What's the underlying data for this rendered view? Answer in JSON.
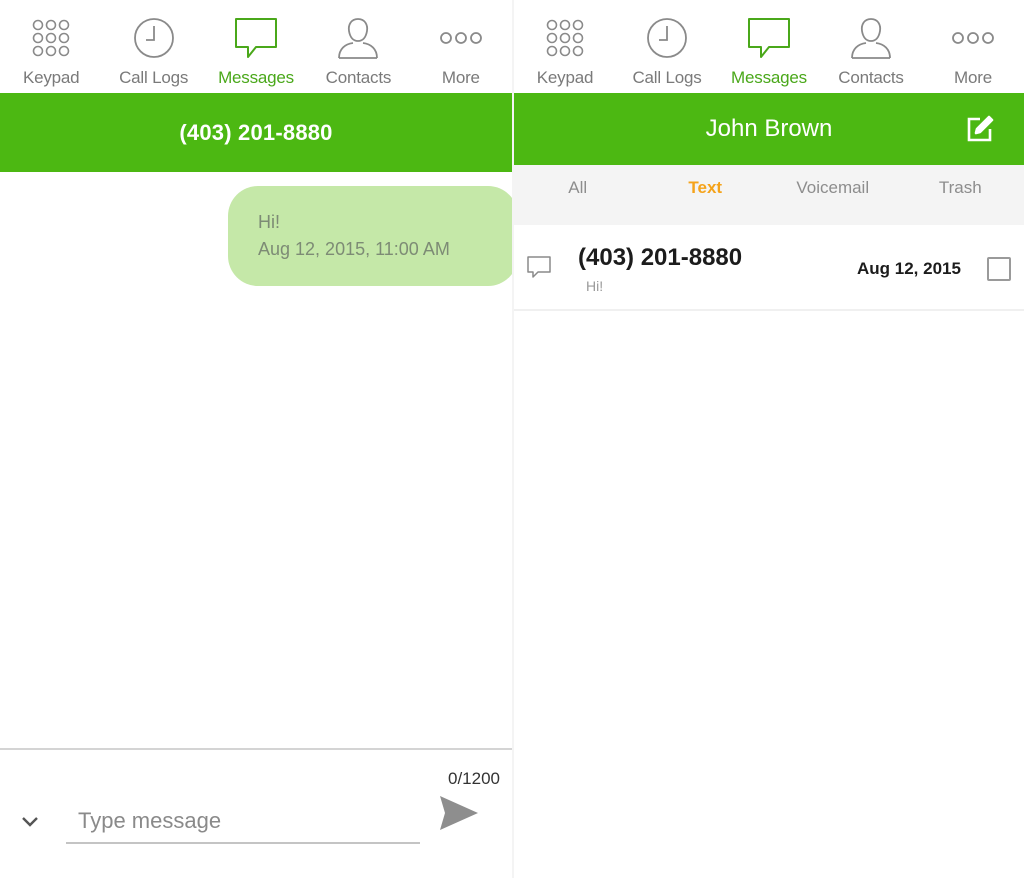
{
  "tabs": [
    {
      "label": "Keypad",
      "icon": "keypad-icon"
    },
    {
      "label": "Call Logs",
      "icon": "clock-icon"
    },
    {
      "label": "Messages",
      "icon": "chat-bubble-icon",
      "active": true
    },
    {
      "label": "Contacts",
      "icon": "person-icon"
    },
    {
      "label": "More",
      "icon": "more-dots-icon"
    }
  ],
  "colors": {
    "brand_green": "#4cb812",
    "active_tab_green": "#4aa81a",
    "bubble_green": "#c5e8a8",
    "filter_active_orange": "#f5a31a"
  },
  "conversation": {
    "title": "(403) 201-8880",
    "messages": [
      {
        "text": "Hi!",
        "time": "Aug 12, 2015, 11:00 AM",
        "direction": "outgoing"
      }
    ],
    "composer": {
      "placeholder": "Type message",
      "value": "",
      "counter": "0/1200"
    }
  },
  "inbox": {
    "title": "John Brown",
    "filters": [
      {
        "label": "All"
      },
      {
        "label": "Text",
        "active": true
      },
      {
        "label": "Voicemail"
      },
      {
        "label": "Trash"
      }
    ],
    "items": [
      {
        "number": "(403) 201-8880",
        "preview": "Hi!",
        "date": "Aug 12, 2015",
        "checked": false
      }
    ]
  }
}
